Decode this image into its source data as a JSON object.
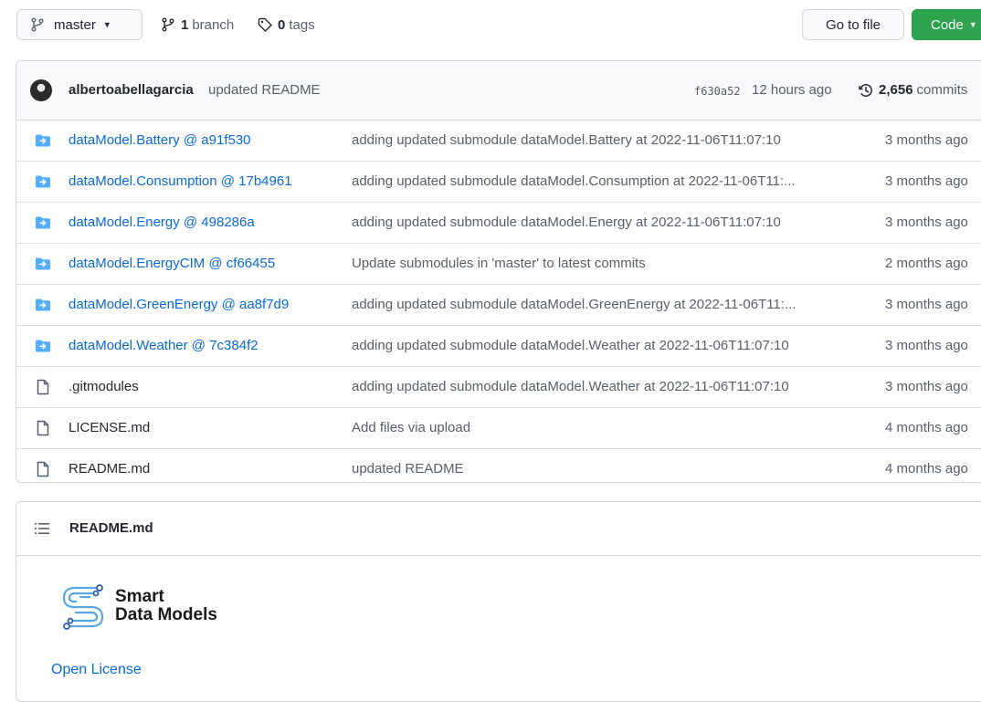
{
  "toolbar": {
    "branch_name": "master",
    "branch_count": "1",
    "branch_word": "branch",
    "tag_count": "0",
    "tag_word": "tags",
    "goto_label": "Go to file",
    "code_label": "Code"
  },
  "commit": {
    "author": "albertoabellagarcia",
    "message": "updated README",
    "hash": "f630a52",
    "time": "12 hours ago",
    "count": "2,656",
    "count_word": "commits"
  },
  "files": [
    {
      "icon": "submodule-folder-icon",
      "name": "dataModel.Battery @ a91f530",
      "message": "adding updated submodule dataModel.Battery at 2022-11-06T11:07:10",
      "age": "3 months ago"
    },
    {
      "icon": "submodule-folder-icon",
      "name": "dataModel.Consumption @ 17b4961",
      "message": "adding updated submodule dataModel.Consumption at 2022-11-06T11:...",
      "age": "3 months ago"
    },
    {
      "icon": "submodule-folder-icon",
      "name": "dataModel.Energy @ 498286a",
      "message": "adding updated submodule dataModel.Energy at 2022-11-06T11:07:10",
      "age": "3 months ago"
    },
    {
      "icon": "submodule-folder-icon",
      "name": "dataModel.EnergyCIM @ cf66455",
      "message": "Update submodules in 'master' to latest commits",
      "age": "2 months ago"
    },
    {
      "icon": "submodule-folder-icon",
      "name": "dataModel.GreenEnergy @ aa8f7d9",
      "message": "adding updated submodule dataModel.GreenEnergy at 2022-11-06T11:...",
      "age": "3 months ago"
    },
    {
      "icon": "submodule-folder-icon",
      "name": "dataModel.Weather @ 7c384f2",
      "message": "adding updated submodule dataModel.Weather at 2022-11-06T11:07:10",
      "age": "3 months ago"
    },
    {
      "icon": "file-icon",
      "name": ".gitmodules",
      "message": "adding updated submodule dataModel.Weather at 2022-11-06T11:07:10",
      "age": "3 months ago"
    },
    {
      "icon": "file-icon",
      "name": "LICENSE.md",
      "message": "Add files via upload",
      "age": "4 months ago"
    },
    {
      "icon": "file-icon",
      "name": "README.md",
      "message": "updated README",
      "age": "4 months ago"
    }
  ],
  "readme": {
    "title": "README.md",
    "logo_line1": "Smart",
    "logo_line2": "Data Models",
    "license_link": "Open License"
  },
  "colors": {
    "link": "#0969da",
    "code_button": "#2da44e",
    "folder": "#54aeff"
  }
}
